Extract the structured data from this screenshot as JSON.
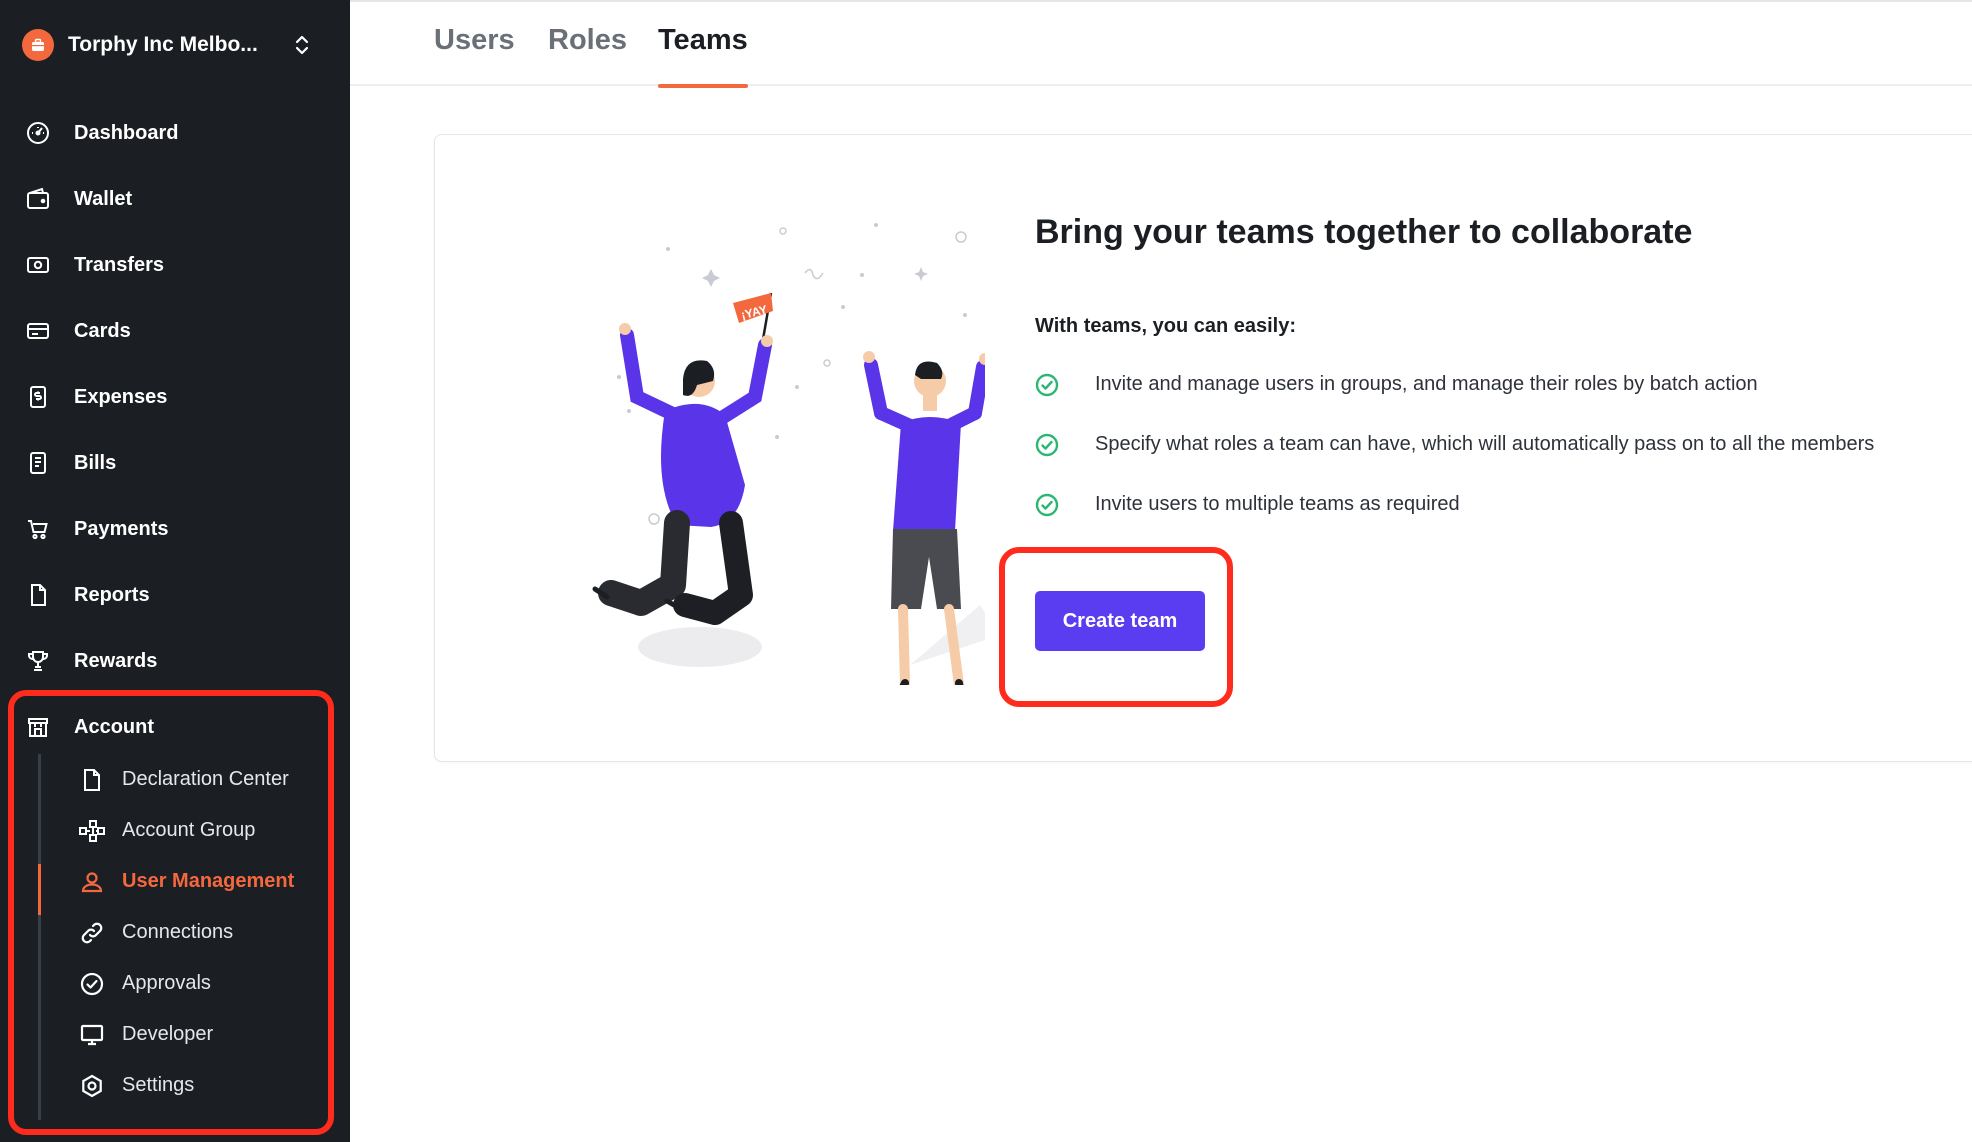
{
  "org": {
    "name": "Torphy Inc Melbo..."
  },
  "nav": [
    {
      "label": "Dashboard",
      "icon": "dashboard-icon"
    },
    {
      "label": "Wallet",
      "icon": "wallet-icon"
    },
    {
      "label": "Transfers",
      "icon": "transfers-icon"
    },
    {
      "label": "Cards",
      "icon": "card-icon"
    },
    {
      "label": "Expenses",
      "icon": "expenses-icon"
    },
    {
      "label": "Bills",
      "icon": "bills-icon"
    },
    {
      "label": "Payments",
      "icon": "cart-icon"
    },
    {
      "label": "Reports",
      "icon": "report-icon"
    },
    {
      "label": "Rewards",
      "icon": "trophy-icon"
    },
    {
      "label": "Account",
      "icon": "store-icon"
    }
  ],
  "subnav": [
    {
      "label": "Declaration Center",
      "icon": "document-icon"
    },
    {
      "label": "Account Group",
      "icon": "hierarchy-icon"
    },
    {
      "label": "User Management",
      "icon": "user-icon",
      "active": true
    },
    {
      "label": "Connections",
      "icon": "link-icon"
    },
    {
      "label": "Approvals",
      "icon": "check-circle-icon"
    },
    {
      "label": "Developer",
      "icon": "monitor-icon"
    },
    {
      "label": "Settings",
      "icon": "gear-icon"
    }
  ],
  "tabs": [
    {
      "label": "Users"
    },
    {
      "label": "Roles"
    },
    {
      "label": "Teams",
      "active": true
    }
  ],
  "card": {
    "headline": "Bring your teams together to collaborate",
    "subhead": "With teams, you can easily:",
    "benefits": [
      "Invite and manage users in groups, and manage their roles by batch action",
      "Specify what roles a team can have, which will automatically pass on to all the members",
      "Invite users to multiple teams as required"
    ],
    "cta": "Create team",
    "flag_text": "¡YAY"
  },
  "colors": {
    "sidebar_bg": "#1b1e23",
    "accent": "#f4683e",
    "primary_button": "#5a3df0",
    "check_green": "#2bb673",
    "highlight_red": "#ff2b1c"
  }
}
